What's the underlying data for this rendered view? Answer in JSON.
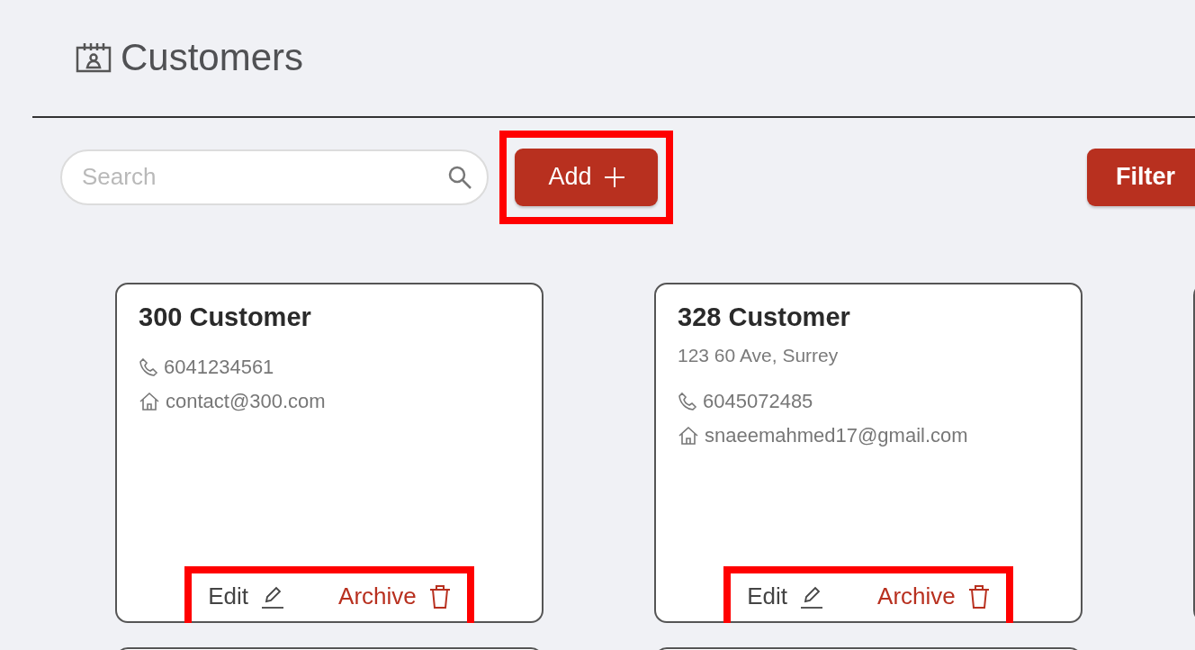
{
  "header": {
    "title": "Customers"
  },
  "toolbar": {
    "search": {
      "placeholder": "Search"
    },
    "add_button": {
      "label": "Add",
      "highlighted": true
    },
    "filter_button": {
      "label": "Filter"
    }
  },
  "cards": [
    {
      "kind": "full",
      "name": "300 Customer",
      "phone": "6041234561",
      "email": "contact@300.com",
      "edit_label": "Edit",
      "archive_label": "Archive",
      "highlighted": true
    },
    {
      "kind": "full",
      "name": "328 Customer",
      "address": "123 60 Ave, Surrey",
      "phone": "6045072485",
      "email": "snaeemahmed17@gmail.com",
      "edit_label": "Edit",
      "archive_label": "Archive",
      "highlighted": true
    },
    {
      "kind": "cut-off"
    },
    {
      "kind": "cut-off"
    },
    {
      "kind": "cut-off"
    }
  ]
}
